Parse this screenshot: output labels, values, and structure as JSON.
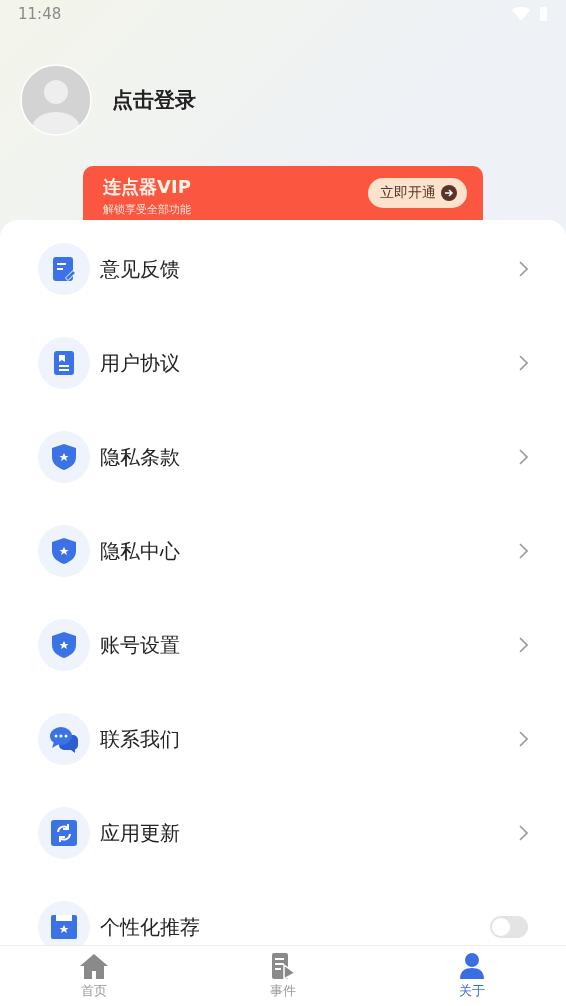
{
  "status_bar": {
    "time": "11:48"
  },
  "profile": {
    "login_label": "点击登录"
  },
  "vip_banner": {
    "title": "连点器VIP",
    "subtitle": "解锁享受全部功能",
    "button": "立即开通"
  },
  "menu": [
    {
      "label": "意见反馈",
      "kind": "link"
    },
    {
      "label": "用户协议",
      "kind": "link"
    },
    {
      "label": "隐私条款",
      "kind": "link"
    },
    {
      "label": "隐私中心",
      "kind": "link"
    },
    {
      "label": "账号设置",
      "kind": "link"
    },
    {
      "label": "联系我们",
      "kind": "link"
    },
    {
      "label": "应用更新",
      "kind": "link"
    },
    {
      "label": "个性化推荐",
      "kind": "toggle",
      "on": false
    }
  ],
  "tab_bar": [
    {
      "label": "首页",
      "selected": false
    },
    {
      "label": "事件",
      "selected": false
    },
    {
      "label": "关于",
      "selected": true
    }
  ]
}
